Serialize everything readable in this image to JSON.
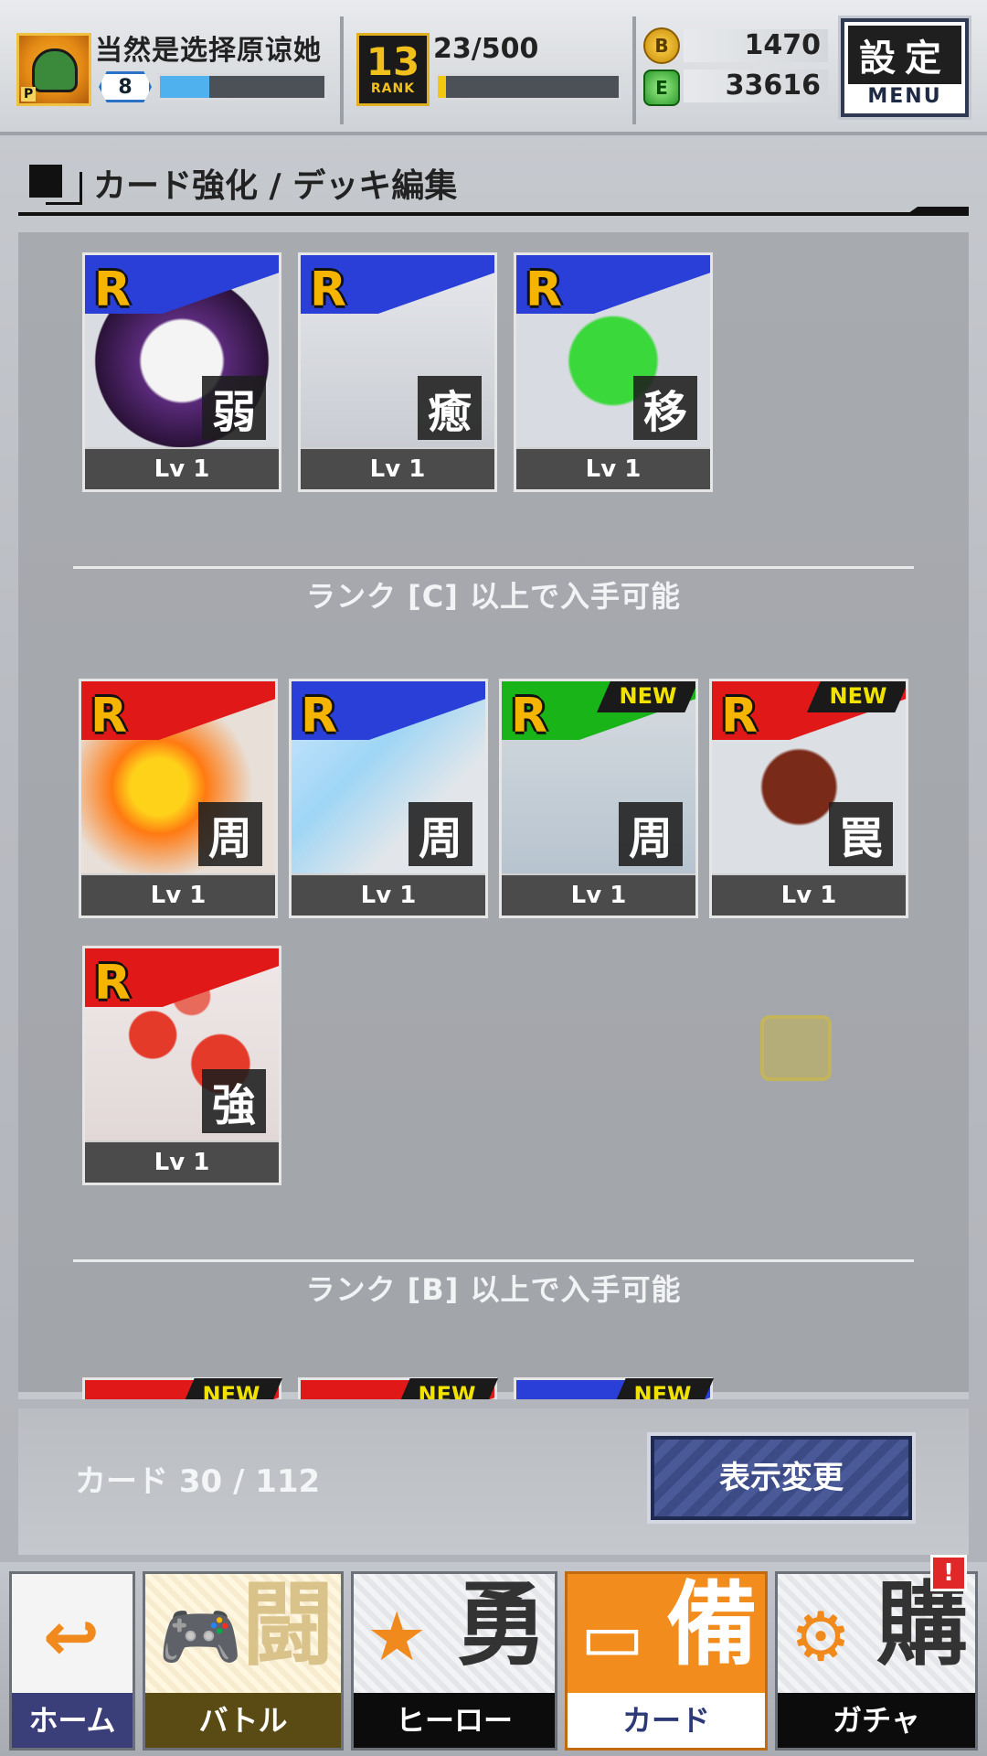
{
  "player": {
    "name": "当然是选择原谅她",
    "level": "8",
    "level_progress": 0.3
  },
  "rank": {
    "badge_number": "13",
    "badge_label": "RANK",
    "progress_text": "23/500",
    "progress": 0.046
  },
  "currency": {
    "gold": "1470",
    "gems": "33616"
  },
  "menu": {
    "kanji": "設定",
    "label": "MENU"
  },
  "section": {
    "title": "カード強化 / デッキ編集"
  },
  "groups": [
    {
      "cards": [
        {
          "rarity": "R",
          "kanji": "弱",
          "level": "Lv 1",
          "color": "#2a3fd8",
          "is_new": false,
          "art": "ghost"
        },
        {
          "rarity": "R",
          "kanji": "癒",
          "level": "Lv 1",
          "color": "#2a3fd8",
          "is_new": false,
          "art": "nun"
        },
        {
          "rarity": "R",
          "kanji": "移",
          "level": "Lv 1",
          "color": "#2a3fd8",
          "is_new": false,
          "art": "pipes"
        }
      ]
    },
    {
      "separator": "ランク [C] 以上で入手可能",
      "cards": [
        {
          "rarity": "R",
          "kanji": "周",
          "level": "Lv 1",
          "color": "#e01818",
          "is_new": false,
          "art": "fire-gauntlet"
        },
        {
          "rarity": "R",
          "kanji": "周",
          "level": "Lv 1",
          "color": "#2a3fd8",
          "is_new": false,
          "art": "sword"
        },
        {
          "rarity": "R",
          "kanji": "周",
          "level": "Lv 1",
          "color": "#18b418",
          "is_new": true,
          "new_label": "NEW",
          "art": "bomber"
        },
        {
          "rarity": "R",
          "kanji": "罠",
          "level": "Lv 1",
          "color": "#e01818",
          "is_new": true,
          "new_label": "NEW",
          "art": "monster"
        },
        {
          "rarity": "R",
          "kanji": "強",
          "level": "Lv 1",
          "color": "#e01818",
          "is_new": false,
          "art": "lanterns"
        }
      ]
    },
    {
      "separator": "ランク [B] 以上で入手可能",
      "cards": [
        {
          "is_new": true,
          "new_label": "NEW",
          "color": "#e01818"
        },
        {
          "is_new": true,
          "new_label": "NEW",
          "color": "#e01818"
        },
        {
          "is_new": true,
          "new_label": "NEW",
          "color": "#2a3fd8"
        }
      ]
    }
  ],
  "footer": {
    "card_count": "カード 30 / 112",
    "view_button": "表示変更"
  },
  "nav": {
    "tabs": [
      {
        "id": "home",
        "label": "ホーム",
        "big": "",
        "icon": "back-arrow-icon"
      },
      {
        "id": "battle",
        "label": "バトル",
        "big": "闘",
        "icon": "gamepad-icon"
      },
      {
        "id": "hero",
        "label": "ヒーロー",
        "big": "勇",
        "icon": "hero-icon"
      },
      {
        "id": "card",
        "label": "カード",
        "big": "備",
        "icon": "cards-icon",
        "active": true
      },
      {
        "id": "gacha",
        "label": "ガチャ",
        "big": "購",
        "icon": "gacha-icon"
      }
    ],
    "alert": "!"
  }
}
